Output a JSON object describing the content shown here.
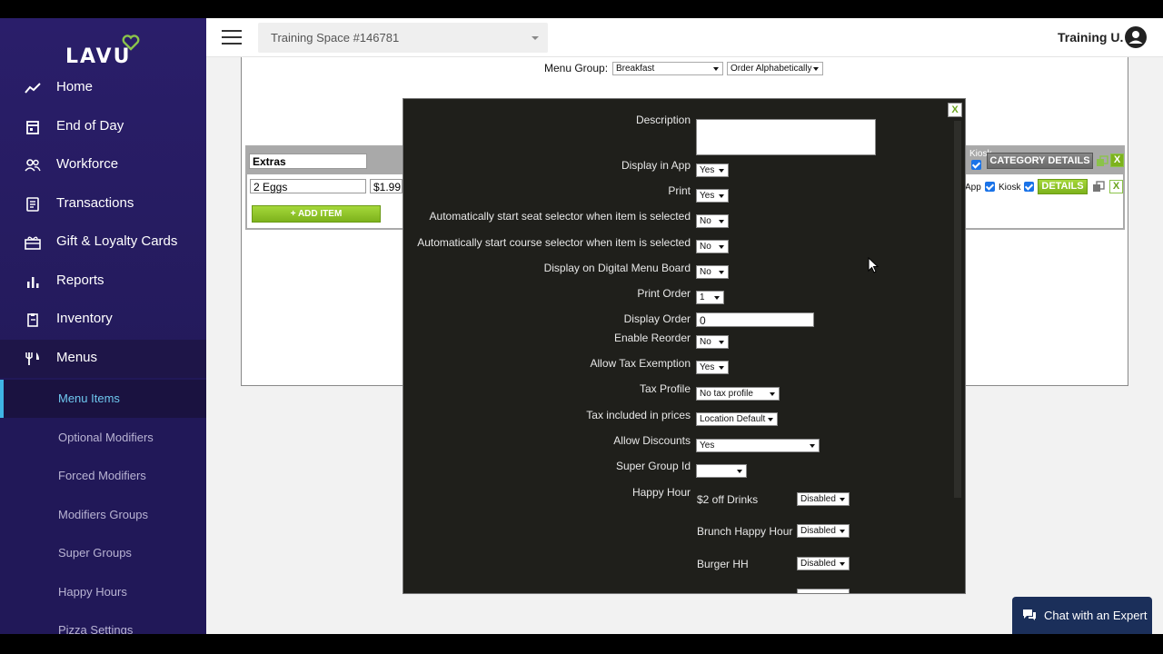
{
  "brand": {
    "logo_text": "LAVU",
    "heart_color": "#8bc34a"
  },
  "sidebar": {
    "items": [
      {
        "label": "Home",
        "icon": "trend-icon"
      },
      {
        "label": "End of Day",
        "icon": "calendar-icon"
      },
      {
        "label": "Workforce",
        "icon": "people-icon"
      },
      {
        "label": "Transactions",
        "icon": "receipt-icon"
      },
      {
        "label": "Gift & Loyalty Cards",
        "icon": "gift-icon"
      },
      {
        "label": "Reports",
        "icon": "bar-chart-icon"
      },
      {
        "label": "Inventory",
        "icon": "clipboard-icon"
      },
      {
        "label": "Menus",
        "icon": "fork-knife-icon"
      }
    ],
    "sub_items": [
      {
        "label": "Menu Items",
        "active": true
      },
      {
        "label": "Optional Modifiers"
      },
      {
        "label": "Forced Modifiers"
      },
      {
        "label": "Modifiers Groups"
      },
      {
        "label": "Super Groups"
      },
      {
        "label": "Happy Hours"
      },
      {
        "label": "Pizza Settings"
      }
    ]
  },
  "topbar": {
    "space_label": "Training Space #146781",
    "user_name": "Training U."
  },
  "menu_group": {
    "label": "Menu Group:",
    "group_value": "Breakfast",
    "order_value": "Order Alphabetically"
  },
  "category": {
    "name": "Extras",
    "category_details_label": "CATEGORY DETAILS",
    "kiosk_label": "Kiosk",
    "item_name": "2 Eggs",
    "item_price": "$1.99",
    "app_label": "App",
    "details_label": "DETAILS",
    "add_item_label": "+ ADD ITEM",
    "close_label": "X"
  },
  "modal": {
    "close_label": "X",
    "fields": [
      {
        "label": "Description",
        "type": "textarea",
        "value": ""
      },
      {
        "label": "Display in App",
        "type": "select",
        "value": "Yes"
      },
      {
        "label": "Print",
        "type": "select",
        "value": "Yes"
      },
      {
        "label": "Automatically start seat selector when item is selected",
        "type": "select",
        "value": "No"
      },
      {
        "label": "Automatically start course selector when item is selected",
        "type": "select",
        "value": "No"
      },
      {
        "label": "Display on Digital Menu Board",
        "type": "select",
        "value": "No"
      },
      {
        "label": "Print Order",
        "type": "select",
        "value": "1"
      },
      {
        "label": "Display Order",
        "type": "text",
        "value": "0"
      },
      {
        "label": "Enable Reorder",
        "type": "select",
        "value": "No"
      },
      {
        "label": "Allow Tax Exemption",
        "type": "select",
        "value": "Yes"
      },
      {
        "label": "Tax Profile",
        "type": "select",
        "value": "No tax profile"
      },
      {
        "label": "Tax included in prices",
        "type": "select",
        "value": "Location Default"
      },
      {
        "label": "Allow Discounts",
        "type": "select",
        "value": "Yes"
      },
      {
        "label": "Super Group Id",
        "type": "select",
        "value": ""
      },
      {
        "label": "Happy Hour",
        "type": "group",
        "value": ""
      }
    ],
    "happy_hours": [
      {
        "name": "$2 off Drinks",
        "value": "Disabled"
      },
      {
        "name": "Brunch Happy Hour",
        "value": "Disabled"
      },
      {
        "name": "Burger HH",
        "value": "Disabled"
      }
    ]
  },
  "chat": {
    "label": "Chat with an Expert"
  },
  "colors": {
    "sidebar": "#2a1e6a",
    "accent": "#3fb5e5",
    "green": "#7db21c",
    "chat": "#1b2f5a"
  }
}
